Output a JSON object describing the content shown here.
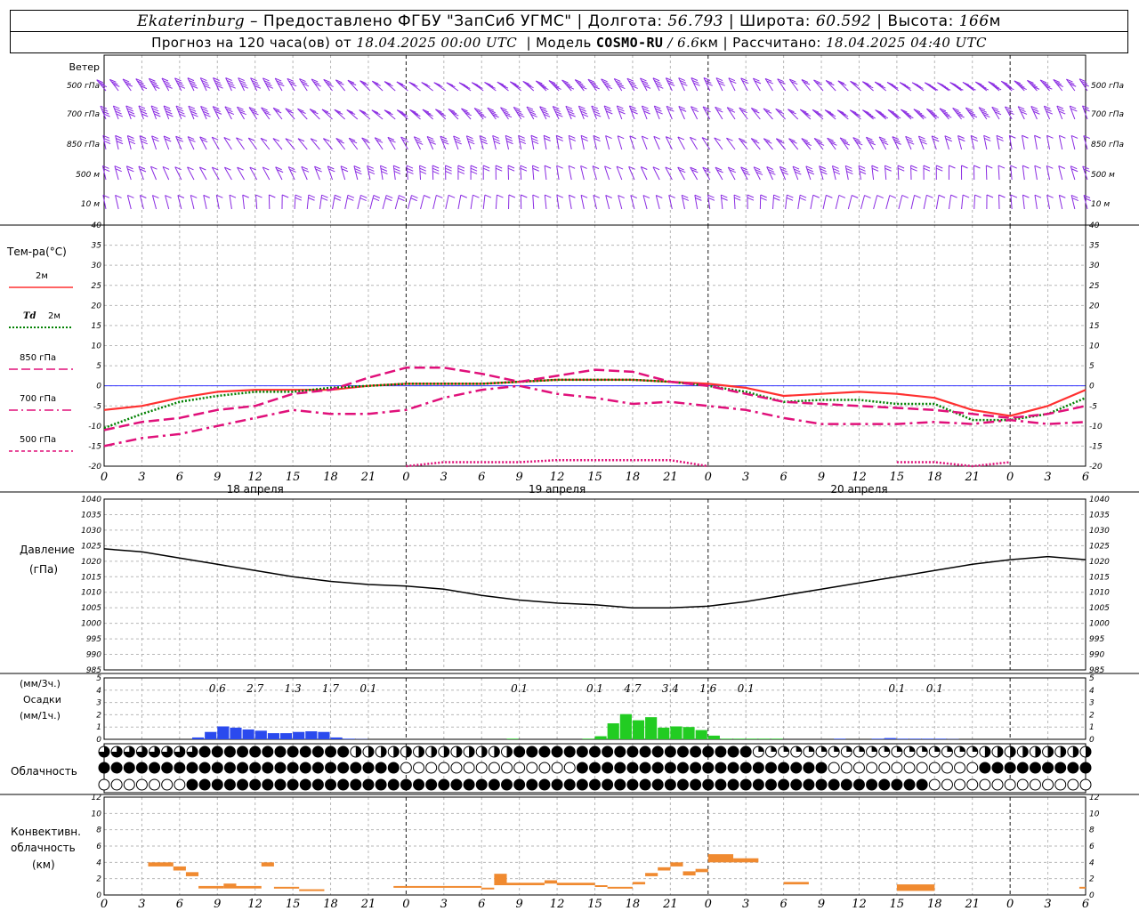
{
  "header": {
    "station": "Ekaterinburg",
    "dash": "–",
    "provider": "Предоставлено ФГБУ \"ЗапСиб УГМС\"",
    "lon_label": "Долгота:",
    "lon_value": "56.793",
    "lat_label": "Широта:",
    "lat_value": "60.592",
    "alt_label": "Высота:",
    "alt_value": "166",
    "alt_unit": "м",
    "forecast_prefix": "Прогноз на 120 часа(ов)  от",
    "forecast_start": "18.04.2025 00:00 UTC",
    "model_label": "Модель",
    "model_name": "COSMO-RU",
    "model_res": "/ 6.6",
    "model_res_unit": "км",
    "calc_label": "Рассчитано:",
    "calc_time": "18.04.2025 04:40 UTC",
    "sep": "|"
  },
  "colors": {
    "wind": "#8a2be2",
    "t2m": "#ff3030",
    "td2m": "#008000",
    "t850": "#e0107a",
    "t700": "#e0107a",
    "t500": "#e0107a",
    "pressure": "#000000",
    "precip_blue": "#2a4aee",
    "precip_green": "#22cc22",
    "conv": "#f08a30",
    "grid": "#999999",
    "zero_line": "#3333ff"
  },
  "x_axis": {
    "hour_ticks": [
      "0",
      "3",
      "6",
      "9",
      "12",
      "15",
      "18",
      "21",
      "0",
      "3",
      "6",
      "9",
      "12",
      "15",
      "18",
      "21",
      "0",
      "3",
      "6",
      "9",
      "12",
      "15",
      "18",
      "21",
      "0",
      "3",
      "6"
    ],
    "day_labels": [
      "18 апреля",
      "19 апреля",
      "20 апреля"
    ]
  },
  "wind_panel": {
    "title": "Ветер",
    "levels": [
      "500 гПа",
      "700 гПа",
      "850 гПа",
      "500 м",
      "10 м"
    ],
    "right_levels": [
      "500 гПа",
      "700 гПа",
      "850 гПа",
      "500 м",
      "10 м"
    ]
  },
  "temp_panel": {
    "title": "Тем-ра(°С)",
    "legend": [
      {
        "label": "2м",
        "style": "solid"
      },
      {
        "label_it": "Td",
        "label": "2м",
        "style": "dotted"
      },
      {
        "label": "850 гПа",
        "style": "longdash"
      },
      {
        "label": "700 гПа",
        "style": "dashdot"
      },
      {
        "label": "500 гПа",
        "style": "dash"
      }
    ],
    "y_ticks": [
      "40",
      "35",
      "30",
      "25",
      "20",
      "15",
      "10",
      "5",
      "0",
      "-5",
      "-10",
      "-15",
      "-20"
    ]
  },
  "pressure_panel": {
    "title": "Давление",
    "unit": "(гПа)",
    "y_ticks": [
      "1040",
      "1035",
      "1030",
      "1025",
      "1020",
      "1015",
      "1010",
      "1005",
      "1000",
      "995",
      "990",
      "985"
    ]
  },
  "precip_panel": {
    "unit_3h": "(мм/3ч.)",
    "title": "Осадки",
    "unit_1h": "(мм/1ч.)",
    "y_ticks": [
      "5",
      "4",
      "3",
      "2",
      "1",
      "0"
    ],
    "totals": [
      {
        "hour": 9,
        "value": "0.6"
      },
      {
        "hour": 12,
        "value": "2.7"
      },
      {
        "hour": 15,
        "value": "1.3"
      },
      {
        "hour": 18,
        "value": "1.7"
      },
      {
        "hour": 21,
        "value": "0.1"
      },
      {
        "hour": 33,
        "value": "0.1"
      },
      {
        "hour": 39,
        "value": "0.1"
      },
      {
        "hour": 42,
        "value": "4.7"
      },
      {
        "hour": 45,
        "value": "3.4"
      },
      {
        "hour": 48,
        "value": "1.6"
      },
      {
        "hour": 51,
        "value": "0.1"
      },
      {
        "hour": 63,
        "value": "0.1"
      },
      {
        "hour": 66,
        "value": "0.1"
      }
    ]
  },
  "cloud_panel": {
    "title": "Облачность"
  },
  "conv_panel": {
    "title_line1": "Конвективн.",
    "title_line2": "облачность",
    "unit": "(км)",
    "y_ticks": [
      "12",
      "10",
      "8",
      "6",
      "4",
      "2",
      "0"
    ]
  },
  "chart_data": [
    {
      "type": "line",
      "title": "Тем-ра(°С)",
      "ylim": [
        -20,
        40
      ],
      "x_unit": "hours since 18.04.2025 00:00 UTC",
      "x": [
        0,
        3,
        6,
        9,
        12,
        15,
        18,
        21,
        24,
        27,
        30,
        33,
        36,
        39,
        42,
        45,
        48,
        51,
        54,
        57,
        60,
        63,
        66,
        69,
        72,
        75,
        78
      ],
      "series": [
        {
          "name": "2м",
          "values": [
            -6,
            -5,
            -3,
            -1.5,
            -1,
            -1,
            -1,
            0,
            0.5,
            0.5,
            0.5,
            1,
            1.5,
            1.5,
            1.5,
            1,
            0.5,
            -0.5,
            -2.5,
            -2,
            -1.5,
            -2,
            -3,
            -6,
            -7.5,
            -5,
            -1
          ]
        },
        {
          "name": "Td 2м",
          "values": [
            -10.5,
            -7,
            -4,
            -2.5,
            -1.5,
            -1.5,
            -0.5,
            0,
            0.5,
            0.5,
            0.5,
            1,
            1.5,
            1.5,
            1.5,
            1,
            0,
            -1.5,
            -4,
            -3.5,
            -3.5,
            -4.5,
            -4.5,
            -8.5,
            -8.5,
            -7,
            -3
          ]
        },
        {
          "name": "850 гПа",
          "values": [
            -11,
            -9,
            -8,
            -6,
            -5,
            -2,
            -1,
            2,
            4.5,
            4.5,
            3,
            1,
            2.5,
            4,
            3.5,
            1,
            0,
            -2,
            -4,
            -4.5,
            -5,
            -5.5,
            -6,
            -7,
            -8,
            -7,
            -5
          ]
        },
        {
          "name": "700 гПа",
          "values": [
            -15,
            -13,
            -12,
            -10,
            -8,
            -6,
            -7,
            -7,
            -6,
            -3,
            -1,
            0,
            -2,
            -3,
            -4.5,
            -4,
            -5,
            -6,
            -8,
            -9.5,
            -9.5,
            -9.5,
            -9,
            -9.5,
            -8.5,
            -9.5,
            -9
          ]
        },
        {
          "name": "500 гПа",
          "values": [
            null,
            null,
            null,
            null,
            null,
            null,
            null,
            null,
            -20,
            -19,
            -19,
            -19,
            -18.5,
            -18.5,
            -18.5,
            -18.5,
            -20,
            null,
            null,
            null,
            null,
            -19,
            -19,
            -20.5,
            -19,
            null,
            null
          ]
        }
      ]
    },
    {
      "type": "line",
      "title": "Давление",
      "ylabel": "(гПа)",
      "ylim": [
        985,
        1040
      ],
      "x_unit": "hours since 18.04.2025 00:00 UTC",
      "x": [
        0,
        3,
        6,
        9,
        12,
        15,
        18,
        21,
        24,
        27,
        30,
        33,
        36,
        39,
        42,
        45,
        48,
        51,
        54,
        57,
        60,
        63,
        66,
        69,
        72,
        75,
        78
      ],
      "series": [
        {
          "name": "Давление",
          "values": [
            1024,
            1023,
            1021,
            1019,
            1017,
            1015,
            1013.5,
            1012.5,
            1012,
            1011,
            1009,
            1007.5,
            1006.5,
            1006,
            1005,
            1005,
            1005.5,
            1007,
            1009,
            1011,
            1013,
            1015,
            1017,
            1019,
            1020.5,
            1021.5,
            1020.5
          ]
        }
      ]
    },
    {
      "type": "bar",
      "title": "Осадки",
      "ylabel": "(мм/1ч.)",
      "ylim": [
        0,
        5
      ],
      "x_unit": "hours since 18.04.2025 00:00 UTC",
      "x": [
        7,
        8,
        9,
        10,
        11,
        12,
        13,
        14,
        15,
        16,
        17,
        18,
        19,
        20,
        32,
        38,
        39,
        40,
        41,
        42,
        43,
        44,
        45,
        46,
        47,
        48,
        49,
        50,
        51,
        52,
        53,
        58,
        61,
        62,
        63,
        64,
        65,
        66,
        67
      ],
      "values": [
        0.15,
        0.6,
        1.05,
        0.95,
        0.8,
        0.7,
        0.5,
        0.5,
        0.6,
        0.65,
        0.6,
        0.15,
        0.05,
        0.02,
        0.05,
        0.05,
        0.25,
        1.3,
        2.05,
        1.55,
        1.8,
        0.95,
        1.05,
        1.0,
        0.75,
        0.3,
        0.05,
        0.05,
        0.05,
        0.05,
        0.05,
        0.05,
        0.05,
        0.1,
        0.05,
        0.05,
        0.05,
        0.05,
        0.02
      ],
      "colors_by_segment": [
        {
          "to": 24,
          "color": "blue"
        },
        {
          "to": 56,
          "color": "green"
        },
        {
          "to": 80,
          "color": "blue"
        }
      ]
    },
    {
      "type": "bar",
      "title": "Конвективн. облачность",
      "ylabel": "(км)",
      "ylim": [
        0,
        12
      ],
      "x_unit": "hours since 18.04.2025 00:00 UTC",
      "segments": [
        {
          "x0": 3.5,
          "x1": 5.5,
          "low": 3.5,
          "high": 4
        },
        {
          "x0": 5.5,
          "x1": 6.5,
          "low": 3,
          "high": 3.5
        },
        {
          "x0": 6.5,
          "x1": 7.5,
          "low": 2.3,
          "high": 2.8
        },
        {
          "x0": 7.5,
          "x1": 9.5,
          "low": 0.8,
          "high": 1.1
        },
        {
          "x0": 9.5,
          "x1": 10.5,
          "low": 0.8,
          "high": 1.4
        },
        {
          "x0": 10.5,
          "x1": 12.5,
          "low": 0.8,
          "high": 1.1
        },
        {
          "x0": 12.5,
          "x1": 13.5,
          "low": 3.5,
          "high": 4
        },
        {
          "x0": 13.5,
          "x1": 15.5,
          "low": 0.8,
          "high": 1
        },
        {
          "x0": 15.5,
          "x1": 17.5,
          "low": 0.5,
          "high": 0.7
        },
        {
          "x0": 23,
          "x1": 30,
          "low": 0.9,
          "high": 1.1
        },
        {
          "x0": 30,
          "x1": 31,
          "low": 0.7,
          "high": 0.9
        },
        {
          "x0": 31,
          "x1": 32,
          "low": 1.2,
          "high": 2.6
        },
        {
          "x0": 32,
          "x1": 35,
          "low": 1.2,
          "high": 1.5
        },
        {
          "x0": 35,
          "x1": 36,
          "low": 1.4,
          "high": 1.8
        },
        {
          "x0": 36,
          "x1": 39,
          "low": 1.2,
          "high": 1.5
        },
        {
          "x0": 39,
          "x1": 40,
          "low": 1.0,
          "high": 1.2
        },
        {
          "x0": 40,
          "x1": 42,
          "low": 0.8,
          "high": 1.0
        },
        {
          "x0": 42,
          "x1": 43,
          "low": 1.3,
          "high": 1.6
        },
        {
          "x0": 43,
          "x1": 44,
          "low": 2.3,
          "high": 2.7
        },
        {
          "x0": 44,
          "x1": 45,
          "low": 3.0,
          "high": 3.4
        },
        {
          "x0": 45,
          "x1": 46,
          "low": 3.5,
          "high": 4
        },
        {
          "x0": 46,
          "x1": 47,
          "low": 2.4,
          "high": 2.9
        },
        {
          "x0": 47,
          "x1": 48,
          "low": 2.8,
          "high": 3.2
        },
        {
          "x0": 48,
          "x1": 50,
          "low": 4.0,
          "high": 5
        },
        {
          "x0": 50,
          "x1": 52,
          "low": 4.0,
          "high": 4.5
        },
        {
          "x0": 54,
          "x1": 56,
          "low": 1.3,
          "high": 1.6
        },
        {
          "x0": 63,
          "x1": 66,
          "low": 0.5,
          "high": 1.3
        },
        {
          "x0": 77.5,
          "x1": 78,
          "low": 0.8,
          "high": 1
        }
      ]
    }
  ]
}
